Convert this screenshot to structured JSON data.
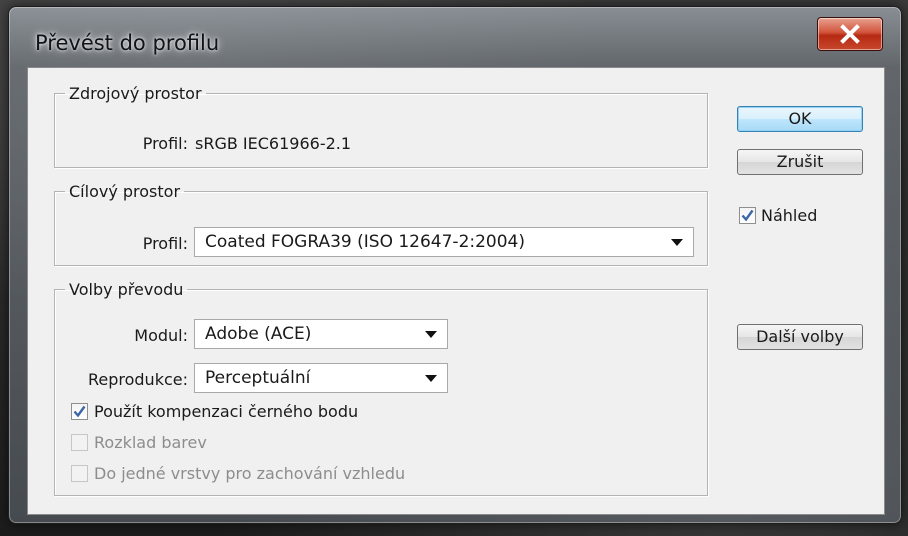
{
  "dialog": {
    "title": "Převést do profilu",
    "close_icon": "close-icon"
  },
  "source_space": {
    "legend": "Zdrojový prostor",
    "profile_label": "Profil:",
    "profile_value": "sRGB IEC61966-2.1"
  },
  "target_space": {
    "legend": "Cílový prostor",
    "profile_label": "Profil:",
    "profile_selected": "Coated FOGRA39 (ISO 12647-2:2004)"
  },
  "conversion_options": {
    "legend": "Volby převodu",
    "module_label": "Modul:",
    "module_selected": "Adobe (ACE)",
    "intent_label": "Reprodukce:",
    "intent_selected": "Perceptuální",
    "checkboxes": [
      {
        "label": "Použít kompenzaci černého bodu",
        "checked": true,
        "enabled": true
      },
      {
        "label": "Rozklad barev",
        "checked": false,
        "enabled": false
      },
      {
        "label": "Do jedné vrstvy pro zachování vzhledu",
        "checked": false,
        "enabled": false
      }
    ]
  },
  "buttons": {
    "ok_label": "OK",
    "cancel_label": "Zrušit",
    "more_options_label": "Další volby"
  },
  "preview": {
    "label": "Náhled",
    "checked": true
  },
  "colors": {
    "accent": "#3c7fb1",
    "close": "#c8482c",
    "check": "#3b66a8"
  }
}
